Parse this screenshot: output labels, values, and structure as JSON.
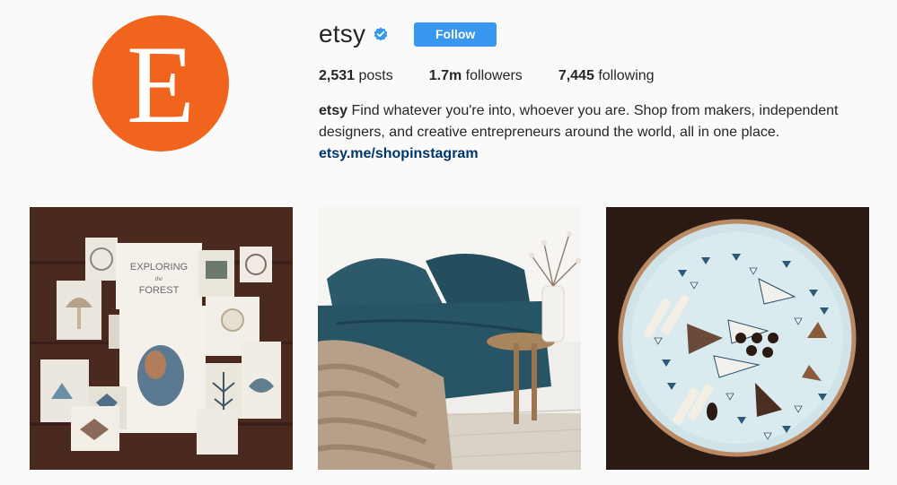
{
  "profile": {
    "avatar_letter": "E",
    "username": "etsy",
    "follow_label": "Follow",
    "stats": {
      "posts_count": "2,531",
      "posts_label": "posts",
      "followers_count": "1.7m",
      "followers_label": "followers",
      "following_count": "7,445",
      "following_label": "following"
    },
    "bio": {
      "name": "etsy",
      "text": "Find whatever you're into, whoever you are. Shop from makers, independent designers, and creative entrepreneurs around the world, all in one place.",
      "link": "etsy.me/shopinstagram"
    }
  },
  "posts": [
    {
      "subject": "illustrated art prints on wooden table",
      "sign_line1": "EXPLORING",
      "sign_line2": "the",
      "sign_line3": "FOREST"
    },
    {
      "subject": "bedroom with teal linen bedding and knit blanket"
    },
    {
      "subject": "ceramic plate with jewelry pieces"
    }
  ],
  "colors": {
    "brand": "#f1641e",
    "follow": "#3897f0",
    "link": "#003569",
    "verified": "#3897f0"
  }
}
